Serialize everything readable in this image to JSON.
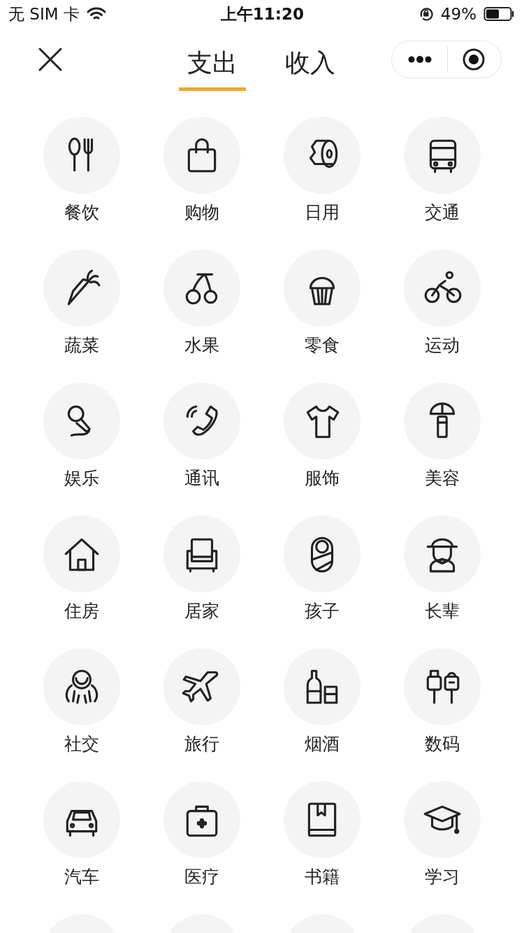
{
  "status_bar": {
    "carrier": "无 SIM 卡",
    "time": "上午11:20",
    "battery": "49%"
  },
  "header": {
    "tabs": [
      {
        "label": "支出",
        "selected": true
      },
      {
        "label": "收入",
        "selected": false
      }
    ]
  },
  "categories": [
    {
      "label": "餐饮"
    },
    {
      "label": "购物"
    },
    {
      "label": "日用"
    },
    {
      "label": "交通"
    },
    {
      "label": "蔬菜"
    },
    {
      "label": "水果"
    },
    {
      "label": "零食"
    },
    {
      "label": "运动"
    },
    {
      "label": "娱乐"
    },
    {
      "label": "通讯"
    },
    {
      "label": "服饰"
    },
    {
      "label": "美容"
    },
    {
      "label": "住房"
    },
    {
      "label": "居家"
    },
    {
      "label": "孩子"
    },
    {
      "label": "长辈"
    },
    {
      "label": "社交"
    },
    {
      "label": "旅行"
    },
    {
      "label": "烟酒"
    },
    {
      "label": "数码"
    },
    {
      "label": "汽车"
    },
    {
      "label": "医疗"
    },
    {
      "label": "书籍"
    },
    {
      "label": "学习"
    }
  ]
}
